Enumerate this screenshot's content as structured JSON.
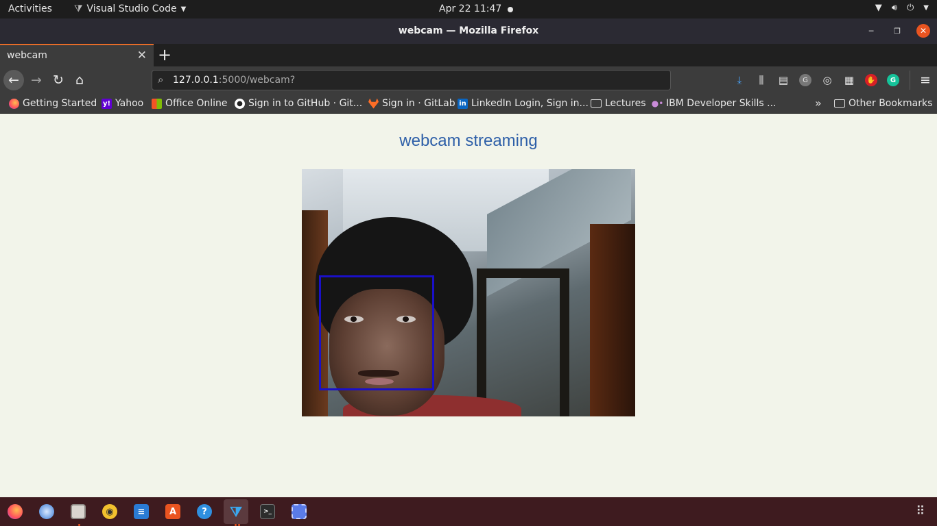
{
  "system_bar": {
    "activities": "Activities",
    "app_name": "Visual Studio Code",
    "clock": "Apr 22  11:47"
  },
  "window": {
    "title": "webcam — Mozilla Firefox"
  },
  "tabs": [
    {
      "label": "webcam",
      "active": true
    }
  ],
  "navigation": {
    "url_host": "127.0.0.1",
    "url_path": ":5000/webcam?"
  },
  "bookmarks": [
    {
      "label": "Getting Started",
      "icon": "firefox-icon"
    },
    {
      "label": "Yahoo",
      "icon": "yahoo-icon"
    },
    {
      "label": "Office Online",
      "icon": "office-icon"
    },
    {
      "label": "Sign in to GitHub · Git...",
      "icon": "github-icon"
    },
    {
      "label": "Sign in · GitLab",
      "icon": "gitlab-icon"
    },
    {
      "label": "LinkedIn Login, Sign in...",
      "icon": "linkedin-icon"
    },
    {
      "label": "Lectures",
      "icon": "folder-icon"
    },
    {
      "label": "IBM Developer Skills ...",
      "icon": "ibm-icon"
    }
  ],
  "other_bookmarks": "Other Bookmarks",
  "page": {
    "heading": "webcam streaming"
  },
  "dock": [
    {
      "name": "firefox",
      "icon": "firefox-icon",
      "running": true
    },
    {
      "name": "thunderbird",
      "icon": "thunderbird-icon",
      "running": false
    },
    {
      "name": "files",
      "icon": "files-icon",
      "running": true
    },
    {
      "name": "rhythmbox",
      "icon": "rhythmbox-icon",
      "running": false
    },
    {
      "name": "libreoffice-writer",
      "icon": "writer-icon",
      "running": false
    },
    {
      "name": "software",
      "icon": "software-store-icon",
      "running": false
    },
    {
      "name": "help",
      "icon": "help-icon",
      "running": false
    },
    {
      "name": "vscode",
      "icon": "vscode-icon",
      "running": true
    },
    {
      "name": "terminal",
      "icon": "terminal-icon",
      "running": false
    },
    {
      "name": "screenshot",
      "icon": "screenshot-icon",
      "running": false
    }
  ],
  "colors": {
    "accent": "#e95420",
    "heading": "#2e5fa8",
    "face_box": "#1a10c8",
    "page_bg": "#f2f4ea"
  }
}
